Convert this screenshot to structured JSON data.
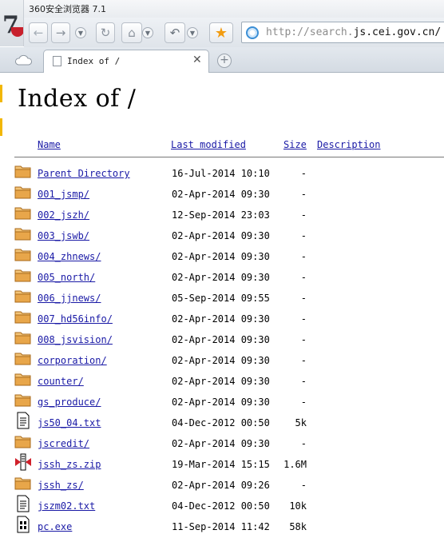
{
  "app": {
    "window_title": "360安全浏览器 7.1"
  },
  "address_bar": {
    "url_prefix": "http://search.",
    "url_highlight": "js.cei.gov.cn/"
  },
  "tab": {
    "title": "Index of /"
  },
  "listing": {
    "heading": "Index of /",
    "columns": {
      "name": "Name",
      "modified": "Last modified",
      "size": "Size",
      "description": "Description"
    },
    "rows": [
      {
        "name": "Parent Directory",
        "modified": "16-Jul-2014 10:10",
        "size": "-",
        "icon": "folder-icon"
      },
      {
        "name": "001_jsmp/",
        "modified": "02-Apr-2014 09:30",
        "size": "-",
        "icon": "folder-icon"
      },
      {
        "name": "002_jszh/",
        "modified": "12-Sep-2014 23:03",
        "size": "-",
        "icon": "folder-icon"
      },
      {
        "name": "003_jswb/",
        "modified": "02-Apr-2014 09:30",
        "size": "-",
        "icon": "folder-icon"
      },
      {
        "name": "004_zhnews/",
        "modified": "02-Apr-2014 09:30",
        "size": "-",
        "icon": "folder-icon"
      },
      {
        "name": "005_north/",
        "modified": "02-Apr-2014 09:30",
        "size": "-",
        "icon": "folder-icon"
      },
      {
        "name": "006_jjnews/",
        "modified": "05-Sep-2014 09:55",
        "size": "-",
        "icon": "folder-icon"
      },
      {
        "name": "007_hd56info/",
        "modified": "02-Apr-2014 09:30",
        "size": "-",
        "icon": "folder-icon"
      },
      {
        "name": "008_jsvision/",
        "modified": "02-Apr-2014 09:30",
        "size": "-",
        "icon": "folder-icon"
      },
      {
        "name": "corporation/",
        "modified": "02-Apr-2014 09:30",
        "size": "-",
        "icon": "folder-icon"
      },
      {
        "name": "counter/",
        "modified": "02-Apr-2014 09:30",
        "size": "-",
        "icon": "folder-icon"
      },
      {
        "name": "gs_produce/",
        "modified": "02-Apr-2014 09:30",
        "size": "-",
        "icon": "folder-icon"
      },
      {
        "name": "js50_04.txt",
        "modified": "04-Dec-2012 00:50",
        "size": "5k",
        "icon": "text-file-icon"
      },
      {
        "name": "jscredit/",
        "modified": "02-Apr-2014 09:30",
        "size": "-",
        "icon": "folder-icon"
      },
      {
        "name": "jssh_zs.zip",
        "modified": "19-Mar-2014 15:15",
        "size": "1.6M",
        "icon": "archive-file-icon"
      },
      {
        "name": "jssh_zs/",
        "modified": "02-Apr-2014 09:26",
        "size": "-",
        "icon": "folder-icon"
      },
      {
        "name": "jszm02.txt",
        "modified": "04-Dec-2012 00:50",
        "size": "10k",
        "icon": "text-file-icon"
      },
      {
        "name": "pc.exe",
        "modified": "11-Sep-2014 11:42",
        "size": "58k",
        "icon": "binary-file-icon"
      }
    ]
  },
  "colors": {
    "link": "#1a1aa6",
    "folder": "#e8a64a",
    "accent_star": "#f29c11"
  }
}
